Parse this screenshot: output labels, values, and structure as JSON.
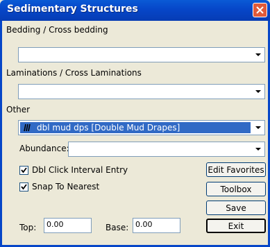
{
  "window": {
    "title": "Sedimentary Structures"
  },
  "fields": {
    "bedding_label": "Bedding / Cross bedding",
    "bedding_value": "",
    "laminations_label": "Laminations / Cross Laminations",
    "laminations_value": "",
    "other_label": "Other",
    "other_value": "dbl mud dps [Double Mud Drapes]",
    "abundance_label": "Abundance:",
    "abundance_value": ""
  },
  "checkboxes": {
    "dbl_click_label": "Dbl Click Interval Entry",
    "dbl_click_checked": true,
    "snap_label": "Snap To Nearest",
    "snap_checked": true
  },
  "buttons": {
    "edit_favorites": "Edit Favorites",
    "toolbox": "Toolbox",
    "save": "Save",
    "exit": "Exit"
  },
  "range": {
    "top_label": "Top:",
    "top_value": "0.00",
    "base_label": "Base:",
    "base_value": "0.00"
  },
  "icons": {
    "close": "close-icon",
    "dropdown": "chevron-down-icon",
    "check": "check-icon",
    "pattern": "pattern-swatch-icon"
  },
  "colors": {
    "titlebar": "#0646c8",
    "selection": "#316ac5",
    "close_button": "#e05a3a",
    "dialog_bg": "#ece9d8"
  }
}
